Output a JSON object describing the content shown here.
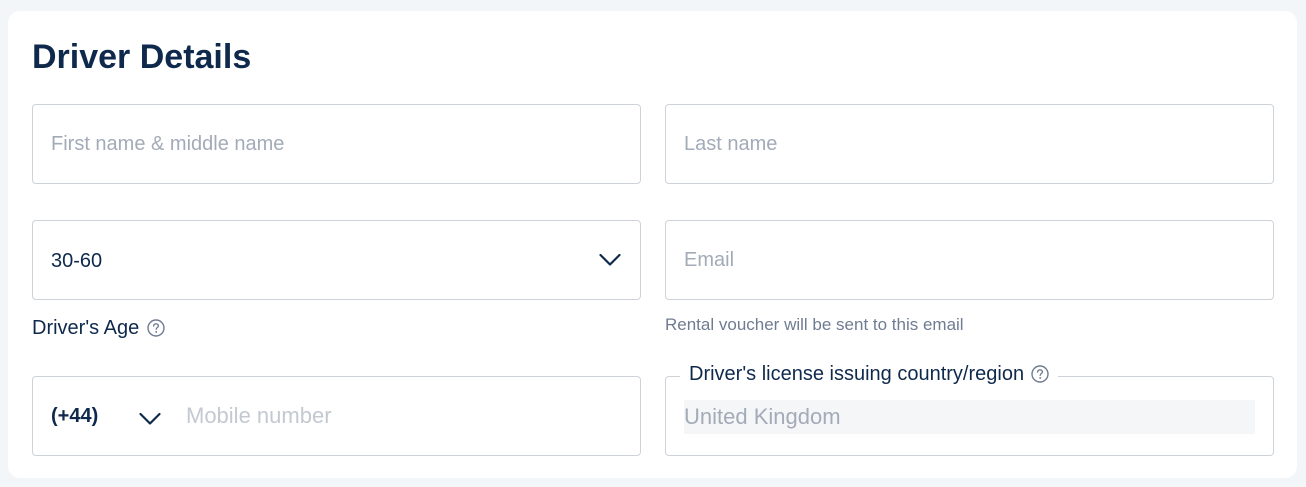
{
  "form": {
    "title": "Driver Details",
    "first_name": {
      "placeholder": "First name & middle name",
      "value": ""
    },
    "last_name": {
      "placeholder": "Last name",
      "value": ""
    },
    "age": {
      "selected": "30-60",
      "label": "Driver's Age",
      "icon": "question-circle-icon"
    },
    "email": {
      "placeholder": "Email",
      "value": "",
      "hint": "Rental voucher will be sent to this email"
    },
    "phone": {
      "country_code": "(+44)",
      "placeholder": "Mobile number",
      "value": ""
    },
    "license_country": {
      "label": "Driver's license issuing country/region",
      "value": "United Kingdom",
      "icon": "question-circle-icon"
    }
  },
  "colors": {
    "title": "#0f294d",
    "border": "#ced2d9",
    "placeholder": "#a3abb8",
    "hint": "#6f7c92",
    "page_background": "#f3f6f9",
    "disabled_fill": "#f5f6f8"
  }
}
